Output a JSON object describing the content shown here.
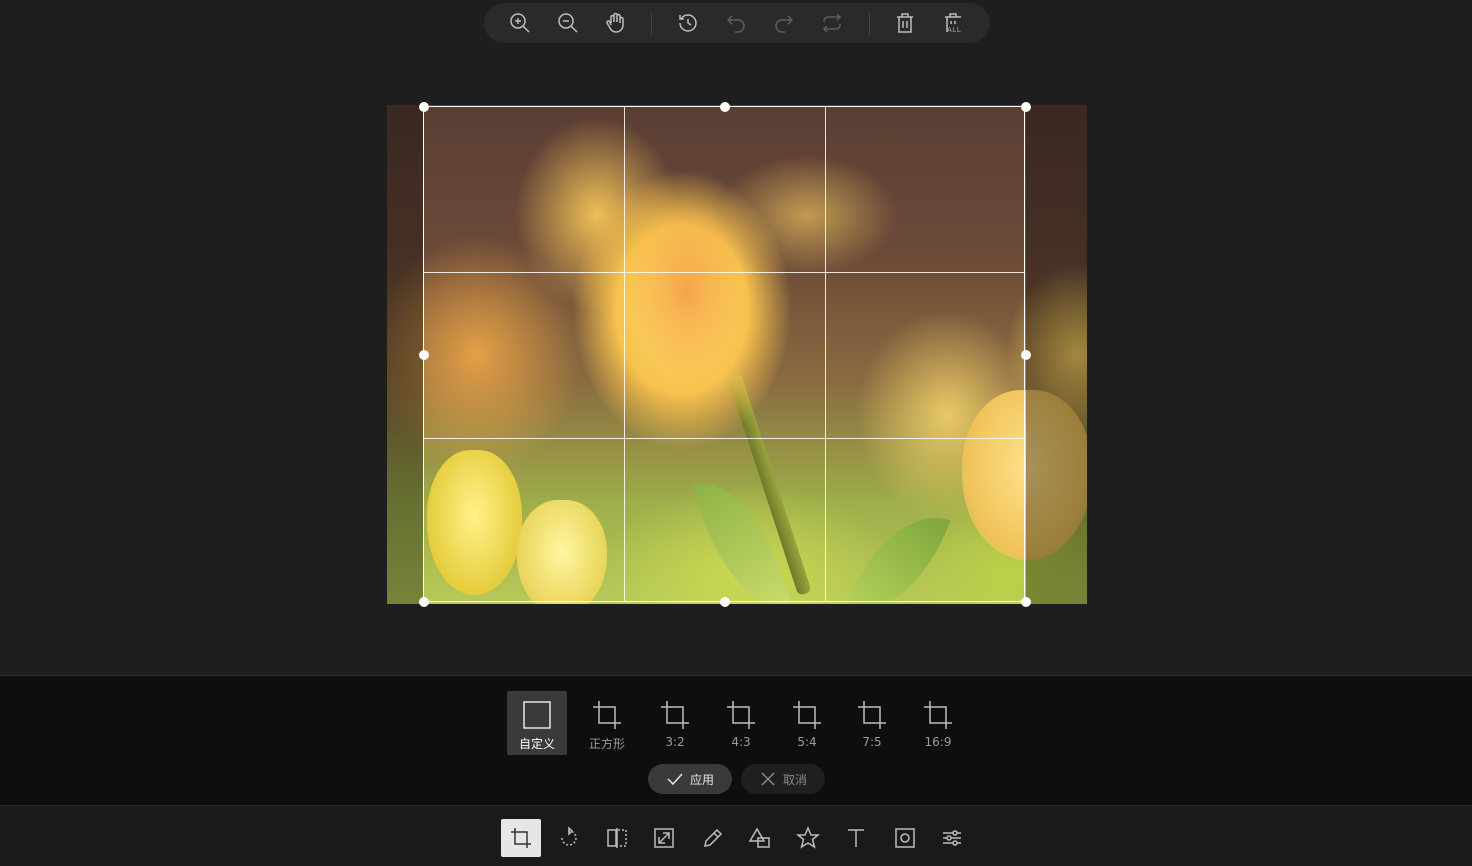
{
  "top_toolbar": {
    "icons": [
      "zoom-in-icon",
      "zoom-out-icon",
      "hand-pan-icon",
      "history-icon",
      "undo-icon",
      "redo-icon",
      "reset-icon",
      "delete-icon",
      "delete-all-icon"
    ],
    "delete_all_label": "ALL"
  },
  "crop_presets": [
    {
      "label": "自定义",
      "active": true
    },
    {
      "label": "正方形",
      "active": false
    },
    {
      "label": "3:2",
      "active": false
    },
    {
      "label": "4:3",
      "active": false
    },
    {
      "label": "5:4",
      "active": false
    },
    {
      "label": "7:5",
      "active": false
    },
    {
      "label": "16:9",
      "active": false
    }
  ],
  "actions": {
    "apply_label": "应用",
    "cancel_label": "取消"
  },
  "main_toolbar": {
    "active": "crop-tool-icon",
    "tools": [
      "crop-tool-icon",
      "rotate-icon",
      "flip-icon",
      "resize-icon",
      "draw-icon",
      "shape-icon",
      "star-icon",
      "text-icon",
      "mask-icon",
      "filter-icon"
    ]
  },
  "colors": {
    "background": "#1e1e1e",
    "panel": "#0e0e0e",
    "active_button": "#3a3a3a",
    "active_tool": "#e6e6e6"
  }
}
